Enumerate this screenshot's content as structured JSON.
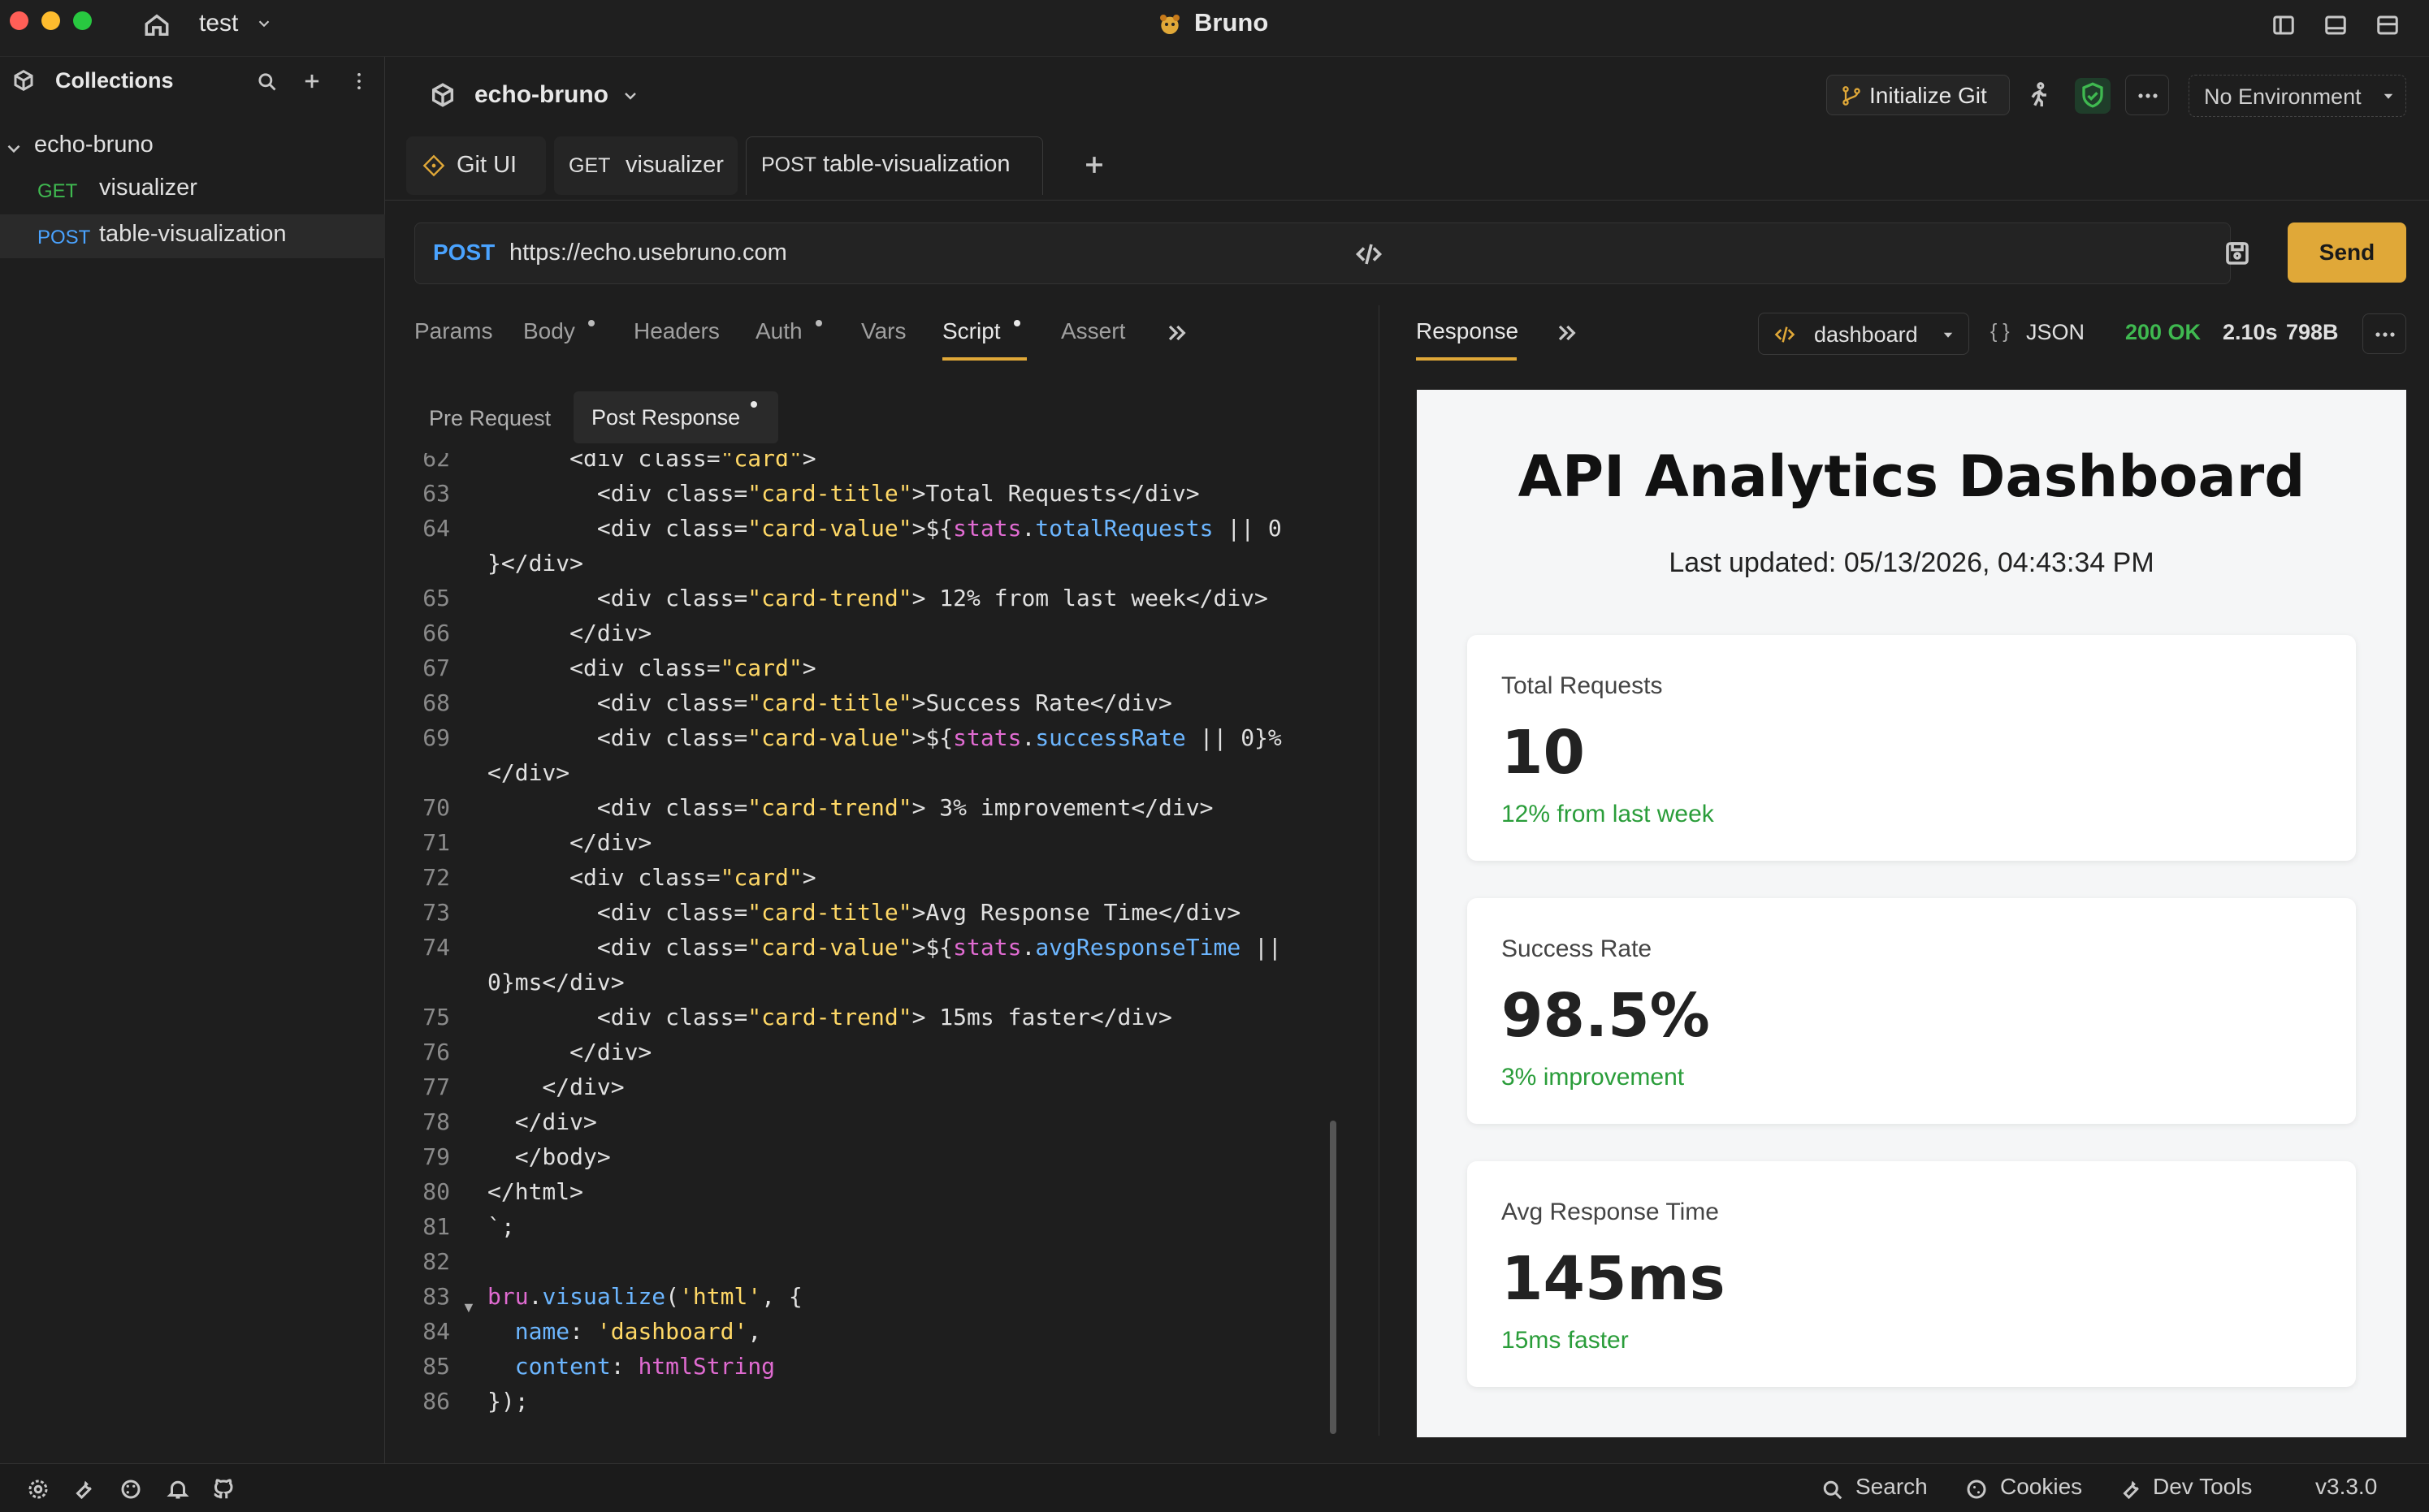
{
  "window": {
    "app_title": "Bruno",
    "workspace": "test"
  },
  "sidebar": {
    "title": "Collections",
    "collection": "echo-bruno",
    "items": [
      {
        "method": "GET",
        "name": "visualizer"
      },
      {
        "method": "POST",
        "name": "table-visualization"
      }
    ]
  },
  "header": {
    "collection_name": "echo-bruno",
    "init_git_label": "Initialize Git",
    "environment": "No Environment"
  },
  "tabs": [
    {
      "method": "",
      "label": "Git UI"
    },
    {
      "method": "GET",
      "label": "visualizer"
    },
    {
      "method": "POST",
      "label": "table-visualization"
    }
  ],
  "request": {
    "method": "POST",
    "url": "https://echo.usebruno.com",
    "send_label": "Send",
    "tabs": [
      "Params",
      "Body",
      "Headers",
      "Auth",
      "Vars",
      "Script",
      "Assert"
    ],
    "active_tab": "Script",
    "script_tabs": [
      "Pre Request",
      "Post Response"
    ]
  },
  "code_lines": [
    {
      "n": "62",
      "t": "      <div class=\"card\">"
    },
    {
      "n": "63",
      "t": "        <div class=\"card-title\">Total Requests</div>"
    },
    {
      "n": "64",
      "t": "        <div class=\"card-value\">${stats.totalRequests || 0"
    },
    {
      "n": "",
      "t": "}</div>"
    },
    {
      "n": "65",
      "t": "        <div class=\"card-trend\"> 12% from last week</div>"
    },
    {
      "n": "66",
      "t": "      </div>"
    },
    {
      "n": "67",
      "t": "      <div class=\"card\">"
    },
    {
      "n": "68",
      "t": "        <div class=\"card-title\">Success Rate</div>"
    },
    {
      "n": "69",
      "t": "        <div class=\"card-value\">${stats.successRate || 0}%"
    },
    {
      "n": "",
      "t": "</div>"
    },
    {
      "n": "70",
      "t": "        <div class=\"card-trend\"> 3% improvement</div>"
    },
    {
      "n": "71",
      "t": "      </div>"
    },
    {
      "n": "72",
      "t": "      <div class=\"card\">"
    },
    {
      "n": "73",
      "t": "        <div class=\"card-title\">Avg Response Time</div>"
    },
    {
      "n": "74",
      "t": "        <div class=\"card-value\">${stats.avgResponseTime ||"
    },
    {
      "n": "",
      "t": "0}ms</div>"
    },
    {
      "n": "75",
      "t": "        <div class=\"card-trend\"> 15ms faster</div>"
    },
    {
      "n": "76",
      "t": "      </div>"
    },
    {
      "n": "77",
      "t": "    </div>"
    },
    {
      "n": "78",
      "t": "  </div>"
    },
    {
      "n": "79",
      "t": "  </body>"
    },
    {
      "n": "80",
      "t": "</html>"
    },
    {
      "n": "81",
      "t": "`;"
    },
    {
      "n": "82",
      "t": ""
    },
    {
      "n": "83",
      "t": "bru.visualize('html', {"
    },
    {
      "n": "84",
      "t": "  name: 'dashboard',"
    },
    {
      "n": "85",
      "t": "  content: htmlString"
    },
    {
      "n": "86",
      "t": "});"
    }
  ],
  "response": {
    "tab_label": "Response",
    "visualizer": "dashboard",
    "format": "JSON",
    "status": "200 OK",
    "time": "2.10s",
    "size": "798B"
  },
  "dashboard": {
    "title": "API Analytics Dashboard",
    "updated": "Last updated: 05/13/2026, 04:43:34 PM",
    "cards": [
      {
        "title": "Total Requests",
        "value": "10",
        "trend": "12% from last week"
      },
      {
        "title": "Success Rate",
        "value": "98.5%",
        "trend": "3% improvement"
      },
      {
        "title": "Avg Response Time",
        "value": "145ms",
        "trend": "15ms faster"
      }
    ]
  },
  "statusbar": {
    "search": "Search",
    "cookies": "Cookies",
    "devtools": "Dev Tools",
    "version": "v3.3.0"
  },
  "colors": {
    "accent": "#e0a838",
    "get": "#3fb950",
    "post": "#4aa3ff",
    "success": "#2a9d3a"
  }
}
